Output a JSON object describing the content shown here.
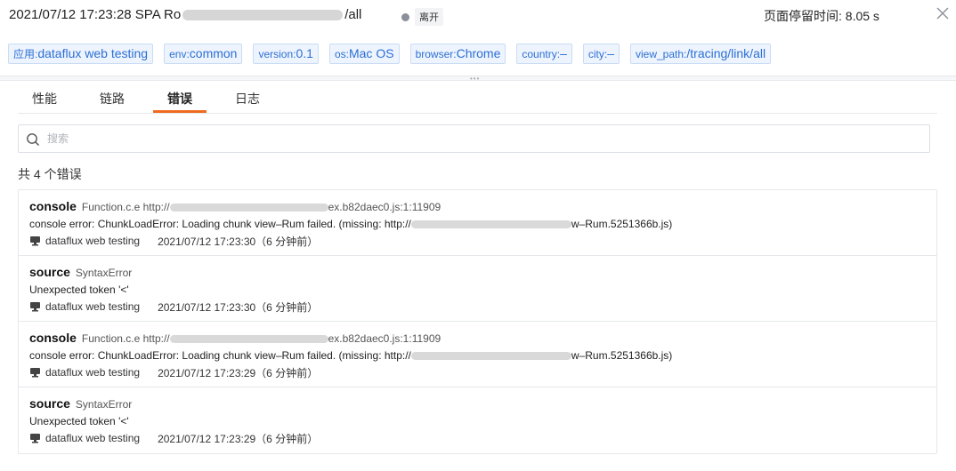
{
  "header": {
    "title_prefix": "2021/07/12 17:23:28  SPA Ro",
    "title_suffix": "/all",
    "status_badge": "离开",
    "stay_time": "页面停留时间:  8.05 s"
  },
  "tags": [
    {
      "key": "应用:",
      "value": "dataflux web testing"
    },
    {
      "key": "env:",
      "value": "common"
    },
    {
      "key": "version:",
      "value": "0.1"
    },
    {
      "key": "os:",
      "value": "Mac OS"
    },
    {
      "key": "browser:",
      "value": "Chrome"
    },
    {
      "key": "country:",
      "value": "–"
    },
    {
      "key": "city:",
      "value": "–"
    },
    {
      "key": "view_path:",
      "value": "/tracing/link/all"
    }
  ],
  "tabs": [
    "性能",
    "链路",
    "错误",
    "日志"
  ],
  "active_tab": "错误",
  "search": {
    "placeholder": "搜索"
  },
  "summary": "共 4 个错误",
  "errors": [
    {
      "type": "console",
      "sub_prefix": "Function.c.e  http://",
      "sub_suffix": "ex.b82daec0.js:1:11909",
      "msg_prefix": "console error: ChunkLoadError: Loading chunk view–Rum failed. (missing: http://",
      "msg_suffix": "w–Rum.5251366b.js)",
      "app": "dataflux web testing",
      "time": "2021/07/12 17:23:30（6 分钟前）"
    },
    {
      "type": "source",
      "sub_prefix": "SyntaxError",
      "sub_suffix": "",
      "msg_prefix": "Unexpected token '<'",
      "msg_suffix": "",
      "app": "dataflux web testing",
      "time": "2021/07/12 17:23:30（6 分钟前）"
    },
    {
      "type": "console",
      "sub_prefix": "Function.c.e  http://",
      "sub_suffix": "ex.b82daec0.js:1:11909",
      "msg_prefix": "console error: ChunkLoadError: Loading chunk view–Rum failed. (missing: http://",
      "msg_suffix": "w–Rum.5251366b.js)",
      "app": "dataflux web testing",
      "time": "2021/07/12 17:23:29（6 分钟前）"
    },
    {
      "type": "source",
      "sub_prefix": "SyntaxError",
      "sub_suffix": "",
      "msg_prefix": "Unexpected token '<'",
      "msg_suffix": "",
      "app": "dataflux web testing",
      "time": "2021/07/12 17:23:29（6 分钟前）"
    }
  ],
  "colors": {
    "accent": "#ef6a1e",
    "tag_text": "#2b6fd6",
    "tag_bg": "#eef4fd"
  }
}
